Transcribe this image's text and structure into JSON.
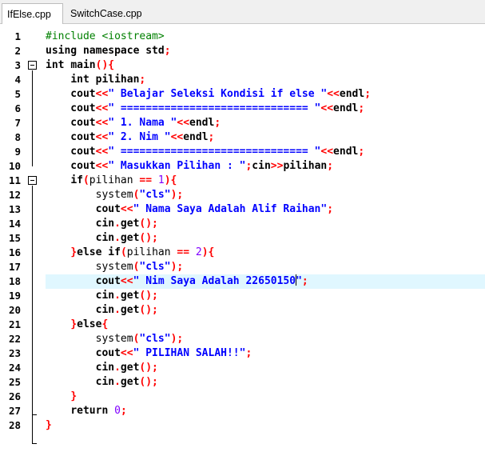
{
  "tabs": [
    {
      "label": "IfElse.cpp",
      "active": true
    },
    {
      "label": "SwitchCase.cpp",
      "active": false
    }
  ],
  "editor": {
    "current_line": 18,
    "line_numbers": [
      "1",
      "2",
      "3",
      "4",
      "5",
      "6",
      "7",
      "8",
      "9",
      "10",
      "11",
      "12",
      "13",
      "14",
      "15",
      "16",
      "17",
      "18",
      "19",
      "20",
      "21",
      "22",
      "23",
      "24",
      "25",
      "26",
      "27",
      "28"
    ],
    "lines": [
      [
        [
          "pre",
          "#include <iostream>"
        ]
      ],
      [
        [
          "kw",
          "using namespace "
        ],
        [
          "id",
          "std"
        ],
        [
          "op",
          ";"
        ]
      ],
      [
        [
          "kw",
          "int "
        ],
        [
          "id",
          "main"
        ],
        [
          "op",
          "(){"
        ]
      ],
      [
        [
          "id",
          "    "
        ],
        [
          "kw",
          "int "
        ],
        [
          "id",
          "pilihan"
        ],
        [
          "op",
          ";"
        ]
      ],
      [
        [
          "id",
          "    cout"
        ],
        [
          "op",
          "<<"
        ],
        [
          "str",
          "\" Belajar Seleksi Kondisi if else \""
        ],
        [
          "op",
          "<<"
        ],
        [
          "id",
          "endl"
        ],
        [
          "op",
          ";"
        ]
      ],
      [
        [
          "id",
          "    cout"
        ],
        [
          "op",
          "<<"
        ],
        [
          "str",
          "\" ============================== \""
        ],
        [
          "op",
          "<<"
        ],
        [
          "id",
          "endl"
        ],
        [
          "op",
          ";"
        ]
      ],
      [
        [
          "id",
          "    cout"
        ],
        [
          "op",
          "<<"
        ],
        [
          "str",
          "\" 1. Nama \""
        ],
        [
          "op",
          "<<"
        ],
        [
          "id",
          "endl"
        ],
        [
          "op",
          ";"
        ]
      ],
      [
        [
          "id",
          "    cout"
        ],
        [
          "op",
          "<<"
        ],
        [
          "str",
          "\" 2. Nim \""
        ],
        [
          "op",
          "<<"
        ],
        [
          "id",
          "endl"
        ],
        [
          "op",
          ";"
        ]
      ],
      [
        [
          "id",
          "    cout"
        ],
        [
          "op",
          "<<"
        ],
        [
          "str",
          "\" ============================== \""
        ],
        [
          "op",
          "<<"
        ],
        [
          "id",
          "endl"
        ],
        [
          "op",
          ";"
        ]
      ],
      [
        [
          "id",
          "    cout"
        ],
        [
          "op",
          "<<"
        ],
        [
          "str",
          "\" Masukkan Pilihan : \""
        ],
        [
          "op",
          ";"
        ],
        [
          "id",
          "cin"
        ],
        [
          "op",
          ">>"
        ],
        [
          "id",
          "pilihan"
        ],
        [
          "op",
          ";"
        ]
      ],
      [
        [
          "id",
          "    "
        ],
        [
          "kw",
          "if"
        ],
        [
          "op",
          "("
        ],
        [
          "fn",
          "pilihan "
        ],
        [
          "op",
          "== "
        ],
        [
          "num",
          "1"
        ],
        [
          "op",
          "){"
        ]
      ],
      [
        [
          "id",
          "        "
        ],
        [
          "fn",
          "system"
        ],
        [
          "op",
          "("
        ],
        [
          "str",
          "\"cls\""
        ],
        [
          "op",
          ");"
        ]
      ],
      [
        [
          "id",
          "        cout"
        ],
        [
          "op",
          "<<"
        ],
        [
          "str",
          "\" Nama Saya Adalah Alif Raihan\""
        ],
        [
          "op",
          ";"
        ]
      ],
      [
        [
          "id",
          "        cin"
        ],
        [
          "op",
          "."
        ],
        [
          "id",
          "get"
        ],
        [
          "op",
          "();"
        ]
      ],
      [
        [
          "id",
          "        cin"
        ],
        [
          "op",
          "."
        ],
        [
          "id",
          "get"
        ],
        [
          "op",
          "();"
        ]
      ],
      [
        [
          "id",
          "    "
        ],
        [
          "op",
          "}"
        ],
        [
          "kw",
          "else if"
        ],
        [
          "op",
          "("
        ],
        [
          "fn",
          "pilihan "
        ],
        [
          "op",
          "== "
        ],
        [
          "num",
          "2"
        ],
        [
          "op",
          "){"
        ]
      ],
      [
        [
          "id",
          "        "
        ],
        [
          "fn",
          "system"
        ],
        [
          "op",
          "("
        ],
        [
          "str",
          "\"cls\""
        ],
        [
          "op",
          ");"
        ]
      ],
      [
        [
          "id",
          "        cout"
        ],
        [
          "op",
          "<<"
        ],
        [
          "str",
          "\" Nim Saya Adalah 22650150"
        ],
        [
          "caret",
          ""
        ],
        [
          "str",
          "\""
        ],
        [
          "op",
          ";"
        ]
      ],
      [
        [
          "id",
          "        cin"
        ],
        [
          "op",
          "."
        ],
        [
          "id",
          "get"
        ],
        [
          "op",
          "();"
        ]
      ],
      [
        [
          "id",
          "        cin"
        ],
        [
          "op",
          "."
        ],
        [
          "id",
          "get"
        ],
        [
          "op",
          "();"
        ]
      ],
      [
        [
          "id",
          "    "
        ],
        [
          "op",
          "}"
        ],
        [
          "kw",
          "else"
        ],
        [
          "op",
          "{"
        ]
      ],
      [
        [
          "id",
          "        "
        ],
        [
          "fn",
          "system"
        ],
        [
          "op",
          "("
        ],
        [
          "str",
          "\"cls\""
        ],
        [
          "op",
          ");"
        ]
      ],
      [
        [
          "id",
          "        cout"
        ],
        [
          "op",
          "<<"
        ],
        [
          "str",
          "\" PILIHAN SALAH!!\""
        ],
        [
          "op",
          ";"
        ]
      ],
      [
        [
          "id",
          "        cin"
        ],
        [
          "op",
          "."
        ],
        [
          "id",
          "get"
        ],
        [
          "op",
          "();"
        ]
      ],
      [
        [
          "id",
          "        cin"
        ],
        [
          "op",
          "."
        ],
        [
          "id",
          "get"
        ],
        [
          "op",
          "();"
        ]
      ],
      [
        [
          "id",
          "    "
        ],
        [
          "op",
          "}"
        ]
      ],
      [
        [
          "id",
          "    "
        ],
        [
          "kw",
          "return "
        ],
        [
          "num",
          "0"
        ],
        [
          "op",
          ";"
        ]
      ],
      [
        [
          "op",
          "}"
        ]
      ]
    ]
  }
}
